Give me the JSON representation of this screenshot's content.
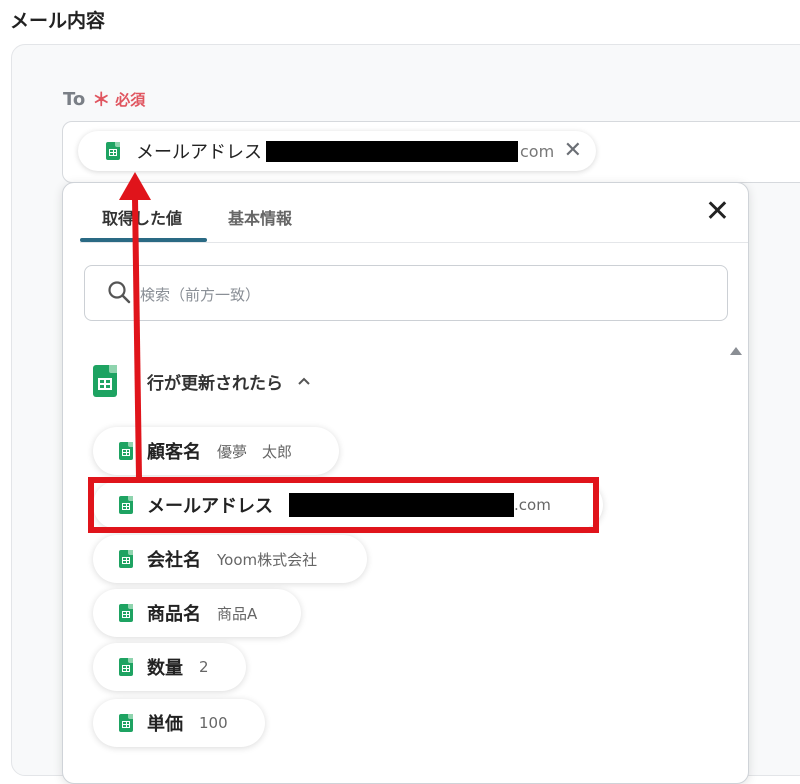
{
  "section": {
    "title": "メール内容"
  },
  "to_field": {
    "label": "To",
    "asterisk": "＊",
    "required": "必須",
    "chip": {
      "label": "メールアドレス",
      "suffix": "com",
      "remove_icon": "close-icon"
    }
  },
  "dropdown": {
    "tabs": [
      {
        "label": "取得した値",
        "active": true
      },
      {
        "label": "基本情報",
        "active": false
      }
    ],
    "close_icon": "close-icon",
    "search": {
      "placeholder": "検索（前方一致）"
    },
    "group": {
      "label": "行が更新されたら",
      "expanded": true,
      "items": [
        {
          "key": "顧客名",
          "value": "優夢　太郎"
        },
        {
          "key": "メールアドレス",
          "value": ".com",
          "redacted": true,
          "highlighted": true
        },
        {
          "key": "会社名",
          "value": "Yoom株式会社"
        },
        {
          "key": "商品名",
          "value": "商品A"
        },
        {
          "key": "数量",
          "value": "2"
        },
        {
          "key": "単価",
          "value": "100"
        }
      ]
    }
  },
  "colors": {
    "accent_tab": "#2a6a84",
    "required": "#e0555f",
    "sheets_green": "#1ea362",
    "annotation_red": "#e0141b"
  }
}
